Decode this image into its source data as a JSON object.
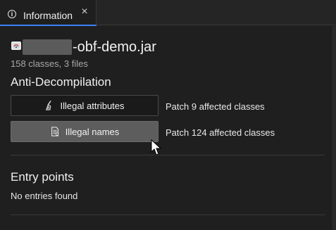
{
  "tab": {
    "label": "Information",
    "icon": "info-icon",
    "close_icon": "close-icon"
  },
  "file": {
    "name_suffix": "-obf-demo.jar",
    "meta": "158 classes, 3 files",
    "icon": "jar-icon"
  },
  "anti_decompilation": {
    "title": "Anti-Decompilation",
    "items": [
      {
        "button_label": "Illegal attributes",
        "icon": "broom-icon",
        "note": "Patch 9 affected classes"
      },
      {
        "button_label": "Illegal names",
        "icon": "document-gear-icon",
        "note": "Patch 124 affected classes"
      }
    ]
  },
  "entry_points": {
    "title": "Entry points",
    "empty_text": "No entries found"
  },
  "colors": {
    "background": "#1f1f1f",
    "tab_accent": "#3b82f6",
    "button_hover": "#5d5d5d"
  }
}
